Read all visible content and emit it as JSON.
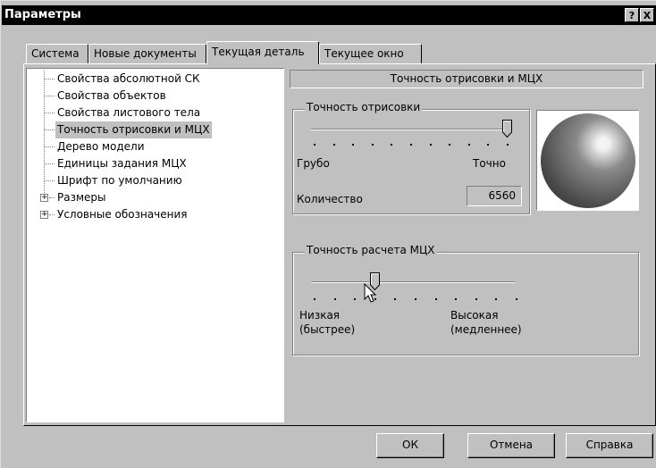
{
  "window": {
    "title": "Параметры",
    "help_button": "?",
    "close_button": "X"
  },
  "tabs": [
    {
      "label": "Система",
      "active": false
    },
    {
      "label": "Новые документы",
      "active": false
    },
    {
      "label": "Текущая деталь",
      "active": true
    },
    {
      "label": "Текущее окно",
      "active": false
    }
  ],
  "tree": {
    "items": [
      {
        "label": "Свойства абсолютной СК",
        "selected": false,
        "expandable": false
      },
      {
        "label": "Свойства объектов",
        "selected": false,
        "expandable": false
      },
      {
        "label": "Свойства листового тела",
        "selected": false,
        "expandable": false
      },
      {
        "label": "Точность отрисовки и МЦХ",
        "selected": true,
        "expandable": false
      },
      {
        "label": "Дерево модели",
        "selected": false,
        "expandable": false
      },
      {
        "label": "Единицы задания МЦХ",
        "selected": false,
        "expandable": false
      },
      {
        "label": "Шрифт по умолчанию",
        "selected": false,
        "expandable": false
      },
      {
        "label": "Размеры",
        "selected": false,
        "expandable": true
      },
      {
        "label": "Условные обозначения",
        "selected": false,
        "expandable": true
      }
    ]
  },
  "panel": {
    "header": "Точность отрисовки и МЦХ",
    "render_group": {
      "title": "Точность отрисовки",
      "slider_level": 1.0,
      "tick_count": 11,
      "min_label": "Грубо",
      "max_label": "Точно",
      "count_label": "Количество",
      "count_value": "6560"
    },
    "mcx_group": {
      "title": "Точность расчета МЦХ",
      "slider_level": 0.3,
      "tick_count": 11,
      "min_label_1": "Низкая",
      "min_label_2": "(быстрее)",
      "max_label_1": "Высокая",
      "max_label_2": "(медленнее)"
    }
  },
  "buttons": {
    "ok": "ОК",
    "cancel": "Отмена",
    "help": "Справка"
  },
  "colors": {
    "face": "#c0c0c0",
    "titlebar": "#000000",
    "sphere_highlight": "#f4f4f4",
    "sphere_mid": "#8a8a8a",
    "sphere_dark": "#2a2a2a"
  }
}
